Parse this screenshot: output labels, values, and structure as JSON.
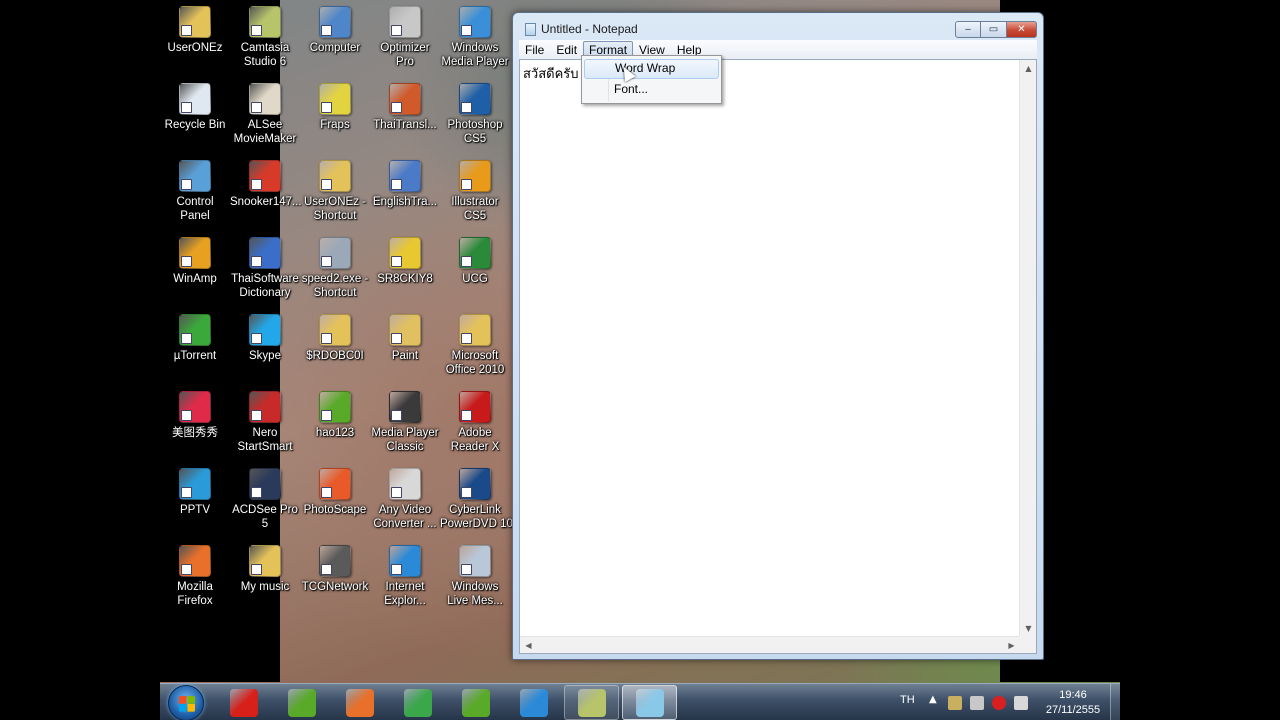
{
  "desktop": {
    "icons": [
      {
        "label": "UserONEz",
        "name": "desktop-icon-userONEz",
        "color": "#e4c25a"
      },
      {
        "label": "Camtasia",
        "label2": "Studio 6",
        "name": "desktop-icon-camtasia",
        "color": "#b8c46a"
      },
      {
        "label": "Computer",
        "name": "desktop-icon-computer",
        "color": "#4f86c9"
      },
      {
        "label": "Optimizer",
        "label2": "Pro",
        "name": "desktop-icon-optimizer-pro",
        "color": "#c8c8c8"
      },
      {
        "label": "Windows",
        "label2": "Media Player",
        "name": "desktop-icon-windows-media-player",
        "color": "#3a8fd8"
      },
      {
        "label": "Recycle Bin",
        "name": "desktop-icon-recycle-bin",
        "color": "#dfe8f0"
      },
      {
        "label": "ALSee",
        "label2": "MovieMaker",
        "name": "desktop-icon-alsee-moviemaker",
        "color": "#e0d8c8"
      },
      {
        "label": "Fraps",
        "name": "desktop-icon-fraps",
        "color": "#e2d440"
      },
      {
        "label": "ThaiTransl...",
        "name": "desktop-icon-thaitransl",
        "color": "#d05a2a"
      },
      {
        "label": "Photoshop",
        "label2": "CS5",
        "name": "desktop-icon-photoshop-cs5",
        "color": "#1f5fa8"
      },
      {
        "label": "Control",
        "label2": "Panel",
        "name": "desktop-icon-control-panel",
        "color": "#5aa0d8"
      },
      {
        "label": "Snooker147...",
        "name": "desktop-icon-snooker147",
        "color": "#d83a2a"
      },
      {
        "label": "UserONEz -",
        "label2": "Shortcut",
        "name": "desktop-icon-userONEz-shortcut",
        "color": "#e4c25a"
      },
      {
        "label": "EnglishTra...",
        "name": "desktop-icon-englishtra",
        "color": "#4a7ac8"
      },
      {
        "label": "Illustrator",
        "label2": "CS5",
        "name": "desktop-icon-illustrator-cs5",
        "color": "#e89a1a"
      },
      {
        "label": "WinAmp",
        "name": "desktop-icon-winamp",
        "color": "#e8a020"
      },
      {
        "label": "ThaiSoftware",
        "label2": "Dictionary",
        "name": "desktop-icon-thaisoftware-dictionary",
        "color": "#3a6ec8"
      },
      {
        "label": "speed2.exe -",
        "label2": "Shortcut",
        "name": "desktop-icon-speed2-shortcut",
        "color": "#9aa8b8"
      },
      {
        "label": "SR8CKIY8",
        "name": "desktop-icon-sr8ckiy8",
        "color": "#e8c830"
      },
      {
        "label": "UCG",
        "name": "desktop-icon-ucg",
        "color": "#2a8a3a"
      },
      {
        "label": "µTorrent",
        "name": "desktop-icon-utorrent",
        "color": "#3aa83a"
      },
      {
        "label": "Skype",
        "name": "desktop-icon-skype",
        "color": "#22a8e8"
      },
      {
        "label": "$RDOBC0I",
        "name": "desktop-icon-rdobc0i",
        "color": "#e4c25a"
      },
      {
        "label": "Paint",
        "name": "desktop-icon-paint",
        "color": "#e0c060"
      },
      {
        "label": "Microsoft",
        "label2": "Office 2010",
        "name": "desktop-icon-microsoft-office-2010",
        "color": "#e4c25a"
      },
      {
        "label": "美图秀秀",
        "name": "desktop-icon-meitu",
        "color": "#e02a4a"
      },
      {
        "label": "Nero",
        "label2": "StartSmart",
        "name": "desktop-icon-nero-startsmart",
        "color": "#c82a2a"
      },
      {
        "label": "hao123",
        "name": "desktop-icon-hao123",
        "color": "#5aaa2a"
      },
      {
        "label": "Media Player",
        "label2": "Classic",
        "name": "desktop-icon-media-player-classic",
        "color": "#3a3a3a"
      },
      {
        "label": "Adobe",
        "label2": "Reader X",
        "name": "desktop-icon-adobe-reader-x",
        "color": "#c81a1a"
      },
      {
        "label": "PPTV",
        "name": "desktop-icon-pptv",
        "color": "#2a9ad8"
      },
      {
        "label": "ACDSee Pro",
        "label2": "5",
        "name": "desktop-icon-acdsee-pro-5",
        "color": "#2a3a5a"
      },
      {
        "label": "PhotoScape",
        "name": "desktop-icon-photoscape",
        "color": "#e85a2a"
      },
      {
        "label": "Any Video",
        "label2": "Converter ...",
        "name": "desktop-icon-any-video-converter",
        "color": "#d8d8d8"
      },
      {
        "label": "CyberLink",
        "label2": "PowerDVD 10",
        "name": "desktop-icon-cyberlink-powerdvd-10",
        "color": "#1a4a8a"
      },
      {
        "label": "Mozilla",
        "label2": "Firefox",
        "name": "desktop-icon-mozilla-firefox",
        "color": "#e8702a"
      },
      {
        "label": "My music",
        "name": "desktop-icon-my-music",
        "color": "#e4c25a"
      },
      {
        "label": "TCGNetwork",
        "name": "desktop-icon-tcgnetwork",
        "color": "#5a5a5a"
      },
      {
        "label": "Internet",
        "label2": "Explor...",
        "name": "desktop-icon-internet-explorer",
        "color": "#2a8ad8"
      },
      {
        "label": "Windows",
        "label2": "Live Mes...",
        "name": "desktop-icon-windows-live-messenger",
        "color": "#b8c8d8"
      }
    ]
  },
  "window": {
    "title": "Untitled - Notepad",
    "menu": [
      "File",
      "Edit",
      "Format",
      "View",
      "Help"
    ],
    "active_menu": "Format",
    "editor_text": "สวัสดีครับ",
    "caption": {
      "minimize": "‒",
      "maximize": "▭",
      "close": "✕"
    }
  },
  "format_menu": {
    "items": [
      "Word Wrap",
      "Font..."
    ],
    "hovered": "Word Wrap"
  },
  "taskbar": {
    "buttons": [
      {
        "name": "taskbar-avira",
        "color": "#d8201a"
      },
      {
        "name": "taskbar-hao123-1",
        "color": "#5aaa2a"
      },
      {
        "name": "taskbar-firefox",
        "color": "#e8702a"
      },
      {
        "name": "taskbar-chrome",
        "color": "#3aa84a"
      },
      {
        "name": "taskbar-hao123-2",
        "color": "#5aaa2a"
      },
      {
        "name": "taskbar-internet-explorer",
        "color": "#2a8ad8"
      },
      {
        "name": "taskbar-camtasia",
        "color": "#b8c46a"
      },
      {
        "name": "taskbar-notepad",
        "color": "#8ac8e8"
      }
    ],
    "tray": {
      "language": "TH",
      "time": "19:46",
      "date": "27/11/2555"
    }
  }
}
